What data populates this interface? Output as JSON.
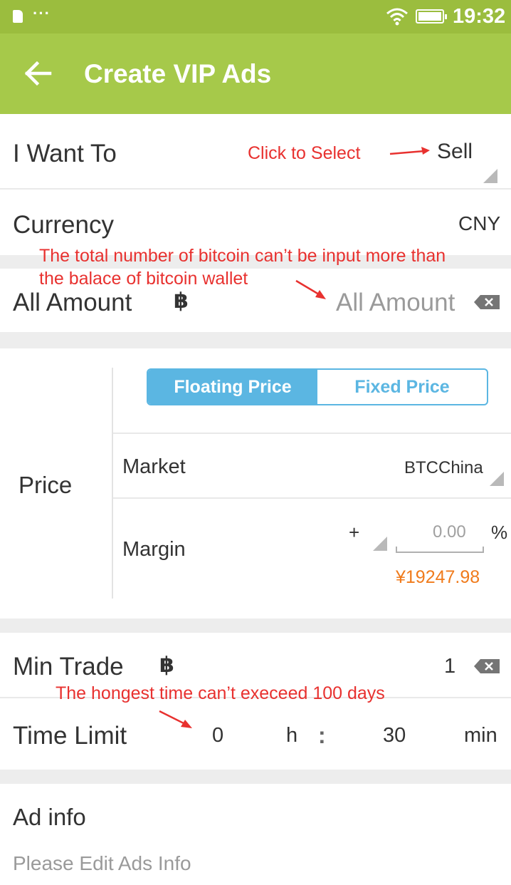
{
  "status_bar": {
    "time": "19:32",
    "dots": "···"
  },
  "app_bar": {
    "title": "Create VIP Ads"
  },
  "want_to": {
    "label": "I Want To",
    "value": "Sell",
    "annotation": "Click to Select"
  },
  "currency": {
    "label": "Currency",
    "value": "CNY"
  },
  "amount": {
    "label": "All Amount",
    "placeholder": "All Amount",
    "symbol": "฿",
    "annotation_line1": "The total number of bitcoin can’t be input more than",
    "annotation_line2": "the balace of bitcoin wallet"
  },
  "price": {
    "label": "Price",
    "tabs": [
      {
        "label": "Floating Price",
        "active": true
      },
      {
        "label": "Fixed Price",
        "active": false
      }
    ],
    "market": {
      "label": "Market",
      "value": "BTCChina"
    },
    "margin": {
      "label": "Margin",
      "sign": "+",
      "value_placeholder": "0.00",
      "unit": "%",
      "computed_price": "¥19247.98"
    }
  },
  "min_trade": {
    "label": "Min Trade",
    "symbol": "฿",
    "value": "1"
  },
  "time_limit": {
    "label": "Time Limit",
    "hours": "0",
    "hours_unit": "h",
    "separator": ":",
    "minutes": "30",
    "minutes_unit": "min",
    "annotation": "The hongest time can’t execeed 100 days"
  },
  "ad_info": {
    "label": "Ad info",
    "placeholder": "Please Edit Ads Info"
  },
  "colors": {
    "header": "#a6c94a",
    "status_bar": "#9bbd3e",
    "accent_blue": "#5bb6e2",
    "annotation_red": "#e8312f",
    "price_orange": "#f07b1c"
  }
}
